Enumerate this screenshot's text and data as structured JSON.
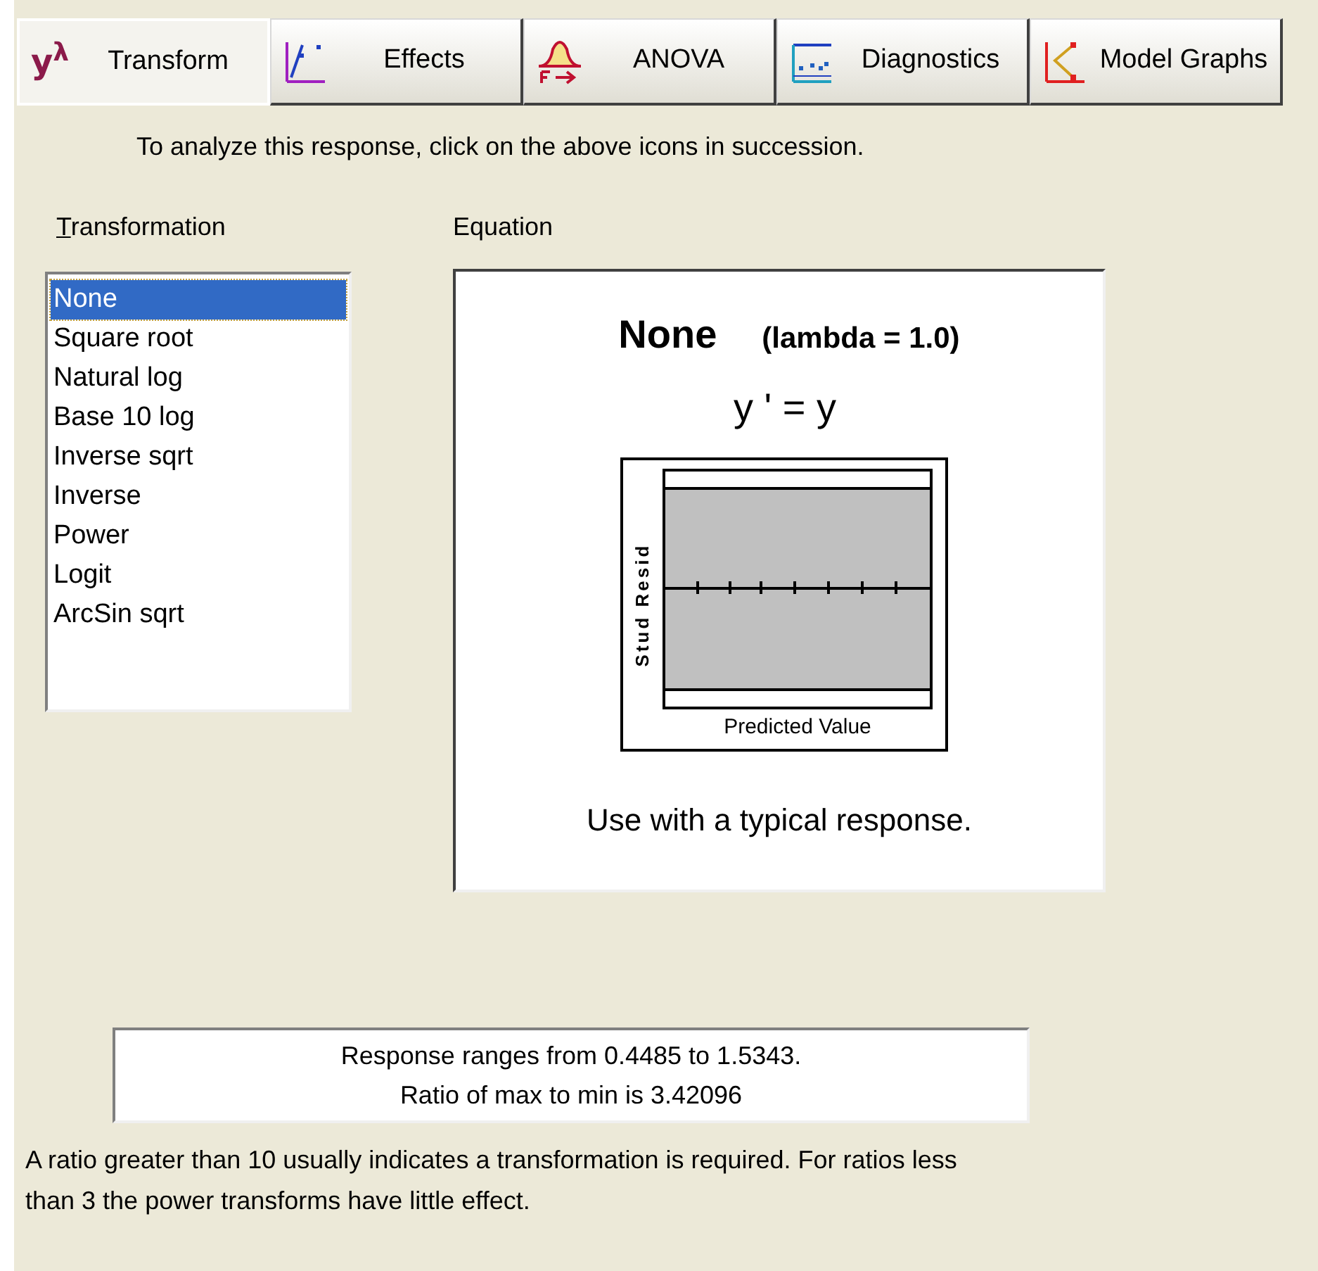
{
  "tabs": [
    {
      "label": "Transform",
      "kind": "lambda",
      "glyph": "y$^{λ}$",
      "selected": true
    },
    {
      "label": "Effects",
      "kind": "effects",
      "selected": false
    },
    {
      "label": "ANOVA",
      "kind": "anova",
      "selected": false
    },
    {
      "label": "Diagnostics",
      "kind": "diagnostics",
      "selected": false
    },
    {
      "label": "Model Graphs",
      "kind": "model-graphs",
      "selected": false
    }
  ],
  "instruction": "To analyze this response, click on the above icons in succession.",
  "transformation": {
    "label": "Transformation",
    "underline_first": true,
    "items": [
      {
        "label": "None",
        "selected": true
      },
      {
        "label": "Square root",
        "selected": false
      },
      {
        "label": "Natural log",
        "selected": false
      },
      {
        "label": "Base 10 log",
        "selected": false
      },
      {
        "label": "Inverse sqrt",
        "selected": false
      },
      {
        "label": "Inverse",
        "selected": false
      },
      {
        "label": "Power",
        "selected": false
      },
      {
        "label": "Logit",
        "selected": false
      },
      {
        "label": "ArcSin sqrt",
        "selected": false
      }
    ]
  },
  "equation": {
    "label": "Equation",
    "name": "None",
    "lambda": "(lambda = 1.0)",
    "formula": "y ' = y",
    "plot": {
      "ylabel": "Stud Resid",
      "xlabel": "Predicted Value"
    },
    "note": "Use with a typical response."
  },
  "response_range": [
    "Response ranges from 0.4485 to 1.5343.",
    "Ratio of max to min is 3.42096"
  ],
  "advice": "A ratio greater than 10 usually indicates a transformation is required.  For ratios less than 3 the power transforms have little effect."
}
